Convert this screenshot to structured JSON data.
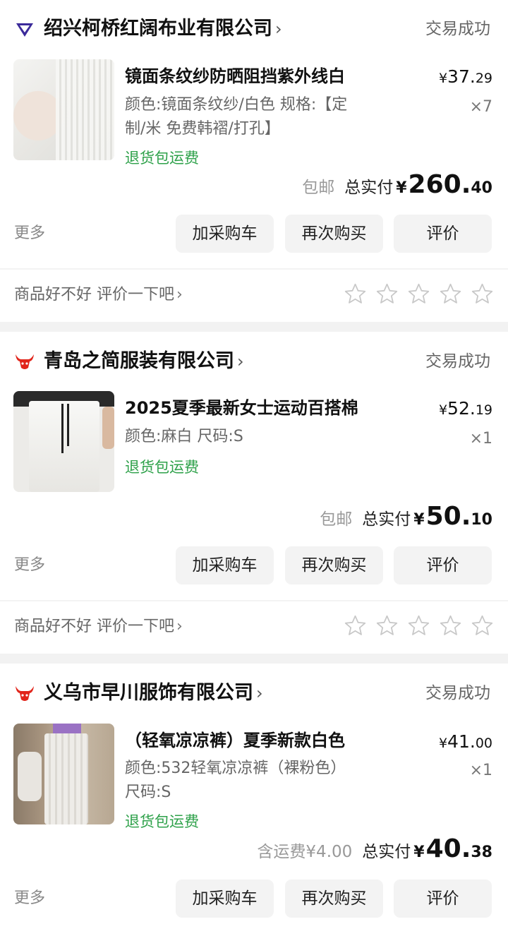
{
  "orders": [
    {
      "shop": {
        "name": "绍兴柯桥红阔布业有限公司",
        "chevron": "›",
        "icon": "diamond-shop-icon"
      },
      "status": "交易成功",
      "product": {
        "title": "镜面条纹纱防晒阻挡紫外线白",
        "spec_line1": "颜色:镜面条纹纱/白色 规格:【定",
        "spec_line2": "制/米 免费韩褶/打孔】",
        "tag": "退货包运费",
        "price_currency": "¥",
        "price_int": "37.",
        "price_dec": "29",
        "qty": "×7"
      },
      "total": {
        "shipping": "包邮",
        "label": "总实付",
        "currency": "¥",
        "int": "260.",
        "dec": "40"
      },
      "actions": {
        "more": "更多",
        "cart": "加采购车",
        "rebuy": "再次购买",
        "review": "评价"
      },
      "rating": {
        "prompt": "商品好不好 评价一下吧",
        "chevron": "›",
        "stars": 5
      }
    },
    {
      "shop": {
        "name": "青岛之简服装有限公司",
        "chevron": "›",
        "icon": "bull-shop-icon"
      },
      "status": "交易成功",
      "product": {
        "title": "2025夏季最新女士运动百搭棉",
        "spec_line1": "颜色:麻白 尺码:S",
        "tag": "退货包运费",
        "price_currency": "¥",
        "price_int": "52.",
        "price_dec": "19",
        "qty": "×1"
      },
      "total": {
        "shipping": "包邮",
        "label": "总实付",
        "currency": "¥",
        "int": "50.",
        "dec": "10"
      },
      "actions": {
        "more": "更多",
        "cart": "加采购车",
        "rebuy": "再次购买",
        "review": "评价"
      },
      "rating": {
        "prompt": "商品好不好 评价一下吧",
        "chevron": "›",
        "stars": 5
      }
    },
    {
      "shop": {
        "name": "义乌市早川服饰有限公司",
        "chevron": "›",
        "icon": "bull-shop-icon"
      },
      "status": "交易成功",
      "product": {
        "title": "（轻氧凉凉裤）夏季新款白色",
        "spec_line1": "颜色:532轻氧凉凉裤（裸粉色）",
        "spec_line2": "尺码:S",
        "tag": "退货包运费",
        "price_currency": "¥",
        "price_int": "41.",
        "price_dec": "00",
        "qty": "×1"
      },
      "total": {
        "shipping": "含运费¥4.00",
        "label": "总实付",
        "currency": "¥",
        "int": "40.",
        "dec": "38"
      },
      "actions": {
        "more": "更多",
        "cart": "加采购车",
        "rebuy": "再次购买",
        "review": "评价"
      }
    }
  ],
  "colors": {
    "tag_green": "#2ea14a",
    "brand_red": "#e1251b",
    "brand_purple": "#3b2a9a",
    "background": "#f2f2f2"
  }
}
